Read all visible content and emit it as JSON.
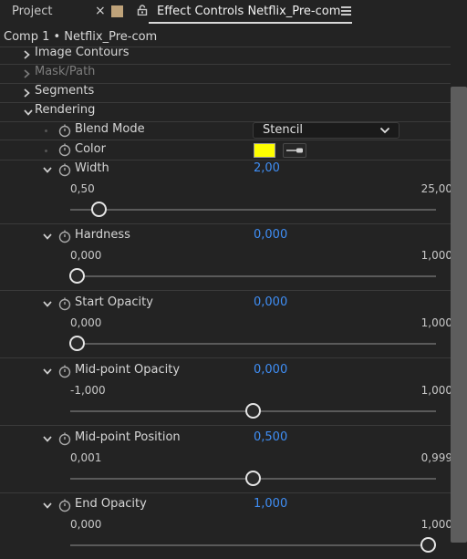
{
  "tabs": {
    "project_label": "Project",
    "close_glyph": "×",
    "active_label": "Effect Controls Netflix_Pre-com",
    "swatch_color": "#bfa37a"
  },
  "breadcrumb": "Comp 1 • Netflix_Pre-com",
  "groups": [
    {
      "label": "Image Contours",
      "expanded": false,
      "enabled": true
    },
    {
      "label": "Mask/Path",
      "expanded": false,
      "enabled": false
    },
    {
      "label": "Segments",
      "expanded": false,
      "enabled": true
    },
    {
      "label": "Rendering",
      "expanded": true,
      "enabled": true
    }
  ],
  "blend_mode": {
    "label": "Blend Mode",
    "value": "Stencil"
  },
  "color": {
    "label": "Color",
    "value": "#ffff00"
  },
  "params": [
    {
      "label": "Width",
      "value": "2,00",
      "min": "0,50",
      "max": "25,00",
      "fraction": 0.0612
    },
    {
      "label": "Hardness",
      "value": "0,000",
      "min": "0,000",
      "max": "1,000",
      "fraction": 0.0
    },
    {
      "label": "Start Opacity",
      "value": "0,000",
      "min": "0,000",
      "max": "1,000",
      "fraction": 0.0
    },
    {
      "label": "Mid-point Opacity",
      "value": "0,000",
      "min": "-1,000",
      "max": "1,000",
      "fraction": 0.5
    },
    {
      "label": "Mid-point Position",
      "value": "0,500",
      "min": "0,001",
      "max": "0,999",
      "fraction": 0.5
    },
    {
      "label": "End Opacity",
      "value": "1,000",
      "min": "0,000",
      "max": "1,000",
      "fraction": 1.0
    }
  ],
  "icons": {
    "lock": "lock-icon",
    "menu": "hamburger-menu-icon",
    "stopwatch": "stopwatch-icon",
    "eyedropper": "eyedropper-icon"
  },
  "colors": {
    "accent_blue": "#3f8ef5",
    "background": "#232323"
  }
}
